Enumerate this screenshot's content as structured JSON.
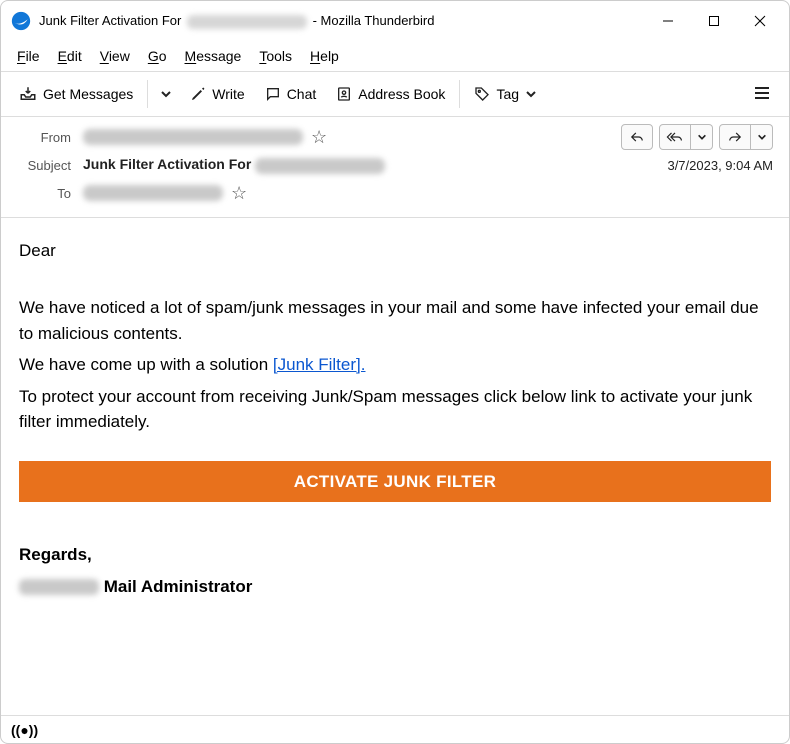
{
  "title": {
    "prefix": "Junk Filter Activation For ",
    "suffix": " - Mozilla Thunderbird"
  },
  "menu": {
    "file": "File",
    "edit": "Edit",
    "view": "View",
    "go": "Go",
    "message": "Message",
    "tools": "Tools",
    "help": "Help"
  },
  "toolbar": {
    "get_messages": "Get Messages",
    "write": "Write",
    "chat": "Chat",
    "address_book": "Address Book",
    "tag": "Tag"
  },
  "headers": {
    "from_label": "From",
    "subject_label": "Subject",
    "to_label": "To",
    "subject_value": "Junk Filter Activation For ",
    "date": "3/7/2023, 9:04 AM"
  },
  "body": {
    "greeting": "Dear",
    "p1": "We have noticed a lot of spam/junk messages in your mail and some have infected your email due to malicious contents.",
    "p2a": "We have come up with a solution ",
    "link": "[Junk Filter].",
    "p3": "To protect your account from receiving Junk/Spam messages click below link to activate your junk filter immediately.",
    "cta": "ACTIVATE JUNK FILTER",
    "regards": "Regards,",
    "sig_suffix": " Mail Administrator"
  }
}
